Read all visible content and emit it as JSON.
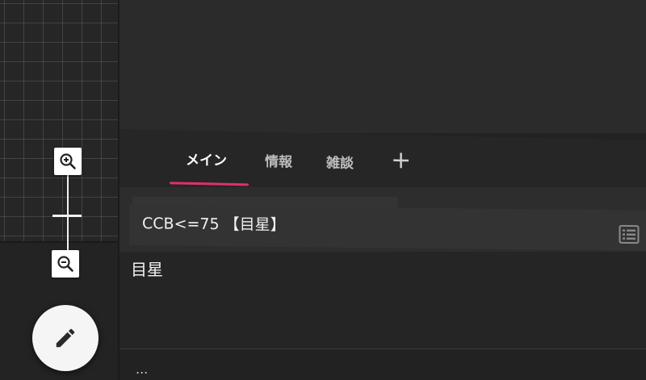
{
  "tabs": [
    {
      "label": "メイン",
      "active": true
    },
    {
      "label": "情報",
      "active": false
    },
    {
      "label": "雑談",
      "active": false
    }
  ],
  "add_tab_label": "+",
  "command": {
    "text": "CCB<=75 【目星】"
  },
  "message": {
    "text": "目星"
  },
  "footer": {
    "text": "..."
  },
  "icons": {
    "zoom_in": "zoom-in-icon",
    "zoom_out": "zoom-out-icon",
    "edit": "pencil-icon",
    "list": "list-icon"
  },
  "colors": {
    "accent": "#e0306a",
    "background": "#222222",
    "fab": "#f5f5f5"
  }
}
